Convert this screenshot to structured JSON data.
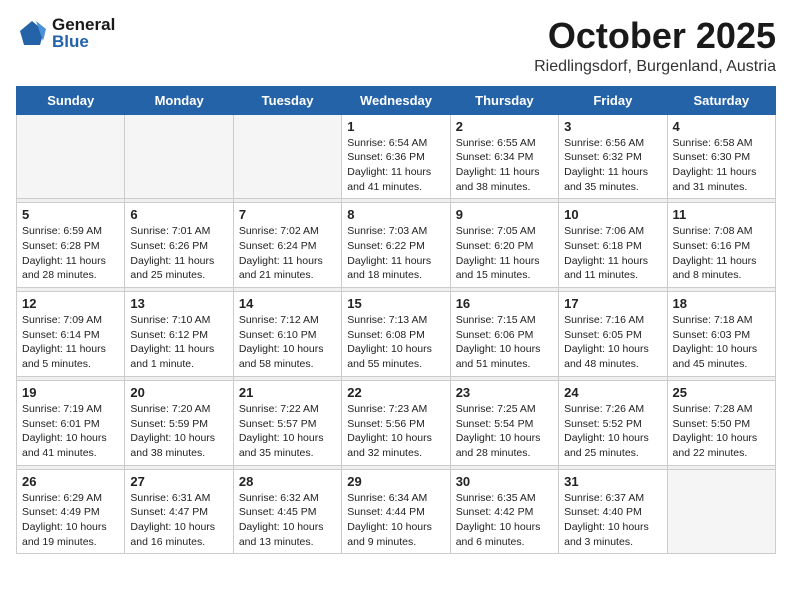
{
  "header": {
    "logo_general": "General",
    "logo_blue": "Blue",
    "month": "October 2025",
    "location": "Riedlingsdorf, Burgenland, Austria"
  },
  "weekdays": [
    "Sunday",
    "Monday",
    "Tuesday",
    "Wednesday",
    "Thursday",
    "Friday",
    "Saturday"
  ],
  "weeks": [
    [
      {
        "day": "",
        "info": ""
      },
      {
        "day": "",
        "info": ""
      },
      {
        "day": "",
        "info": ""
      },
      {
        "day": "1",
        "info": "Sunrise: 6:54 AM\nSunset: 6:36 PM\nDaylight: 11 hours\nand 41 minutes."
      },
      {
        "day": "2",
        "info": "Sunrise: 6:55 AM\nSunset: 6:34 PM\nDaylight: 11 hours\nand 38 minutes."
      },
      {
        "day": "3",
        "info": "Sunrise: 6:56 AM\nSunset: 6:32 PM\nDaylight: 11 hours\nand 35 minutes."
      },
      {
        "day": "4",
        "info": "Sunrise: 6:58 AM\nSunset: 6:30 PM\nDaylight: 11 hours\nand 31 minutes."
      }
    ],
    [
      {
        "day": "5",
        "info": "Sunrise: 6:59 AM\nSunset: 6:28 PM\nDaylight: 11 hours\nand 28 minutes."
      },
      {
        "day": "6",
        "info": "Sunrise: 7:01 AM\nSunset: 6:26 PM\nDaylight: 11 hours\nand 25 minutes."
      },
      {
        "day": "7",
        "info": "Sunrise: 7:02 AM\nSunset: 6:24 PM\nDaylight: 11 hours\nand 21 minutes."
      },
      {
        "day": "8",
        "info": "Sunrise: 7:03 AM\nSunset: 6:22 PM\nDaylight: 11 hours\nand 18 minutes."
      },
      {
        "day": "9",
        "info": "Sunrise: 7:05 AM\nSunset: 6:20 PM\nDaylight: 11 hours\nand 15 minutes."
      },
      {
        "day": "10",
        "info": "Sunrise: 7:06 AM\nSunset: 6:18 PM\nDaylight: 11 hours\nand 11 minutes."
      },
      {
        "day": "11",
        "info": "Sunrise: 7:08 AM\nSunset: 6:16 PM\nDaylight: 11 hours\nand 8 minutes."
      }
    ],
    [
      {
        "day": "12",
        "info": "Sunrise: 7:09 AM\nSunset: 6:14 PM\nDaylight: 11 hours\nand 5 minutes."
      },
      {
        "day": "13",
        "info": "Sunrise: 7:10 AM\nSunset: 6:12 PM\nDaylight: 11 hours\nand 1 minute."
      },
      {
        "day": "14",
        "info": "Sunrise: 7:12 AM\nSunset: 6:10 PM\nDaylight: 10 hours\nand 58 minutes."
      },
      {
        "day": "15",
        "info": "Sunrise: 7:13 AM\nSunset: 6:08 PM\nDaylight: 10 hours\nand 55 minutes."
      },
      {
        "day": "16",
        "info": "Sunrise: 7:15 AM\nSunset: 6:06 PM\nDaylight: 10 hours\nand 51 minutes."
      },
      {
        "day": "17",
        "info": "Sunrise: 7:16 AM\nSunset: 6:05 PM\nDaylight: 10 hours\nand 48 minutes."
      },
      {
        "day": "18",
        "info": "Sunrise: 7:18 AM\nSunset: 6:03 PM\nDaylight: 10 hours\nand 45 minutes."
      }
    ],
    [
      {
        "day": "19",
        "info": "Sunrise: 7:19 AM\nSunset: 6:01 PM\nDaylight: 10 hours\nand 41 minutes."
      },
      {
        "day": "20",
        "info": "Sunrise: 7:20 AM\nSunset: 5:59 PM\nDaylight: 10 hours\nand 38 minutes."
      },
      {
        "day": "21",
        "info": "Sunrise: 7:22 AM\nSunset: 5:57 PM\nDaylight: 10 hours\nand 35 minutes."
      },
      {
        "day": "22",
        "info": "Sunrise: 7:23 AM\nSunset: 5:56 PM\nDaylight: 10 hours\nand 32 minutes."
      },
      {
        "day": "23",
        "info": "Sunrise: 7:25 AM\nSunset: 5:54 PM\nDaylight: 10 hours\nand 28 minutes."
      },
      {
        "day": "24",
        "info": "Sunrise: 7:26 AM\nSunset: 5:52 PM\nDaylight: 10 hours\nand 25 minutes."
      },
      {
        "day": "25",
        "info": "Sunrise: 7:28 AM\nSunset: 5:50 PM\nDaylight: 10 hours\nand 22 minutes."
      }
    ],
    [
      {
        "day": "26",
        "info": "Sunrise: 6:29 AM\nSunset: 4:49 PM\nDaylight: 10 hours\nand 19 minutes."
      },
      {
        "day": "27",
        "info": "Sunrise: 6:31 AM\nSunset: 4:47 PM\nDaylight: 10 hours\nand 16 minutes."
      },
      {
        "day": "28",
        "info": "Sunrise: 6:32 AM\nSunset: 4:45 PM\nDaylight: 10 hours\nand 13 minutes."
      },
      {
        "day": "29",
        "info": "Sunrise: 6:34 AM\nSunset: 4:44 PM\nDaylight: 10 hours\nand 9 minutes."
      },
      {
        "day": "30",
        "info": "Sunrise: 6:35 AM\nSunset: 4:42 PM\nDaylight: 10 hours\nand 6 minutes."
      },
      {
        "day": "31",
        "info": "Sunrise: 6:37 AM\nSunset: 4:40 PM\nDaylight: 10 hours\nand 3 minutes."
      },
      {
        "day": "",
        "info": ""
      }
    ]
  ]
}
